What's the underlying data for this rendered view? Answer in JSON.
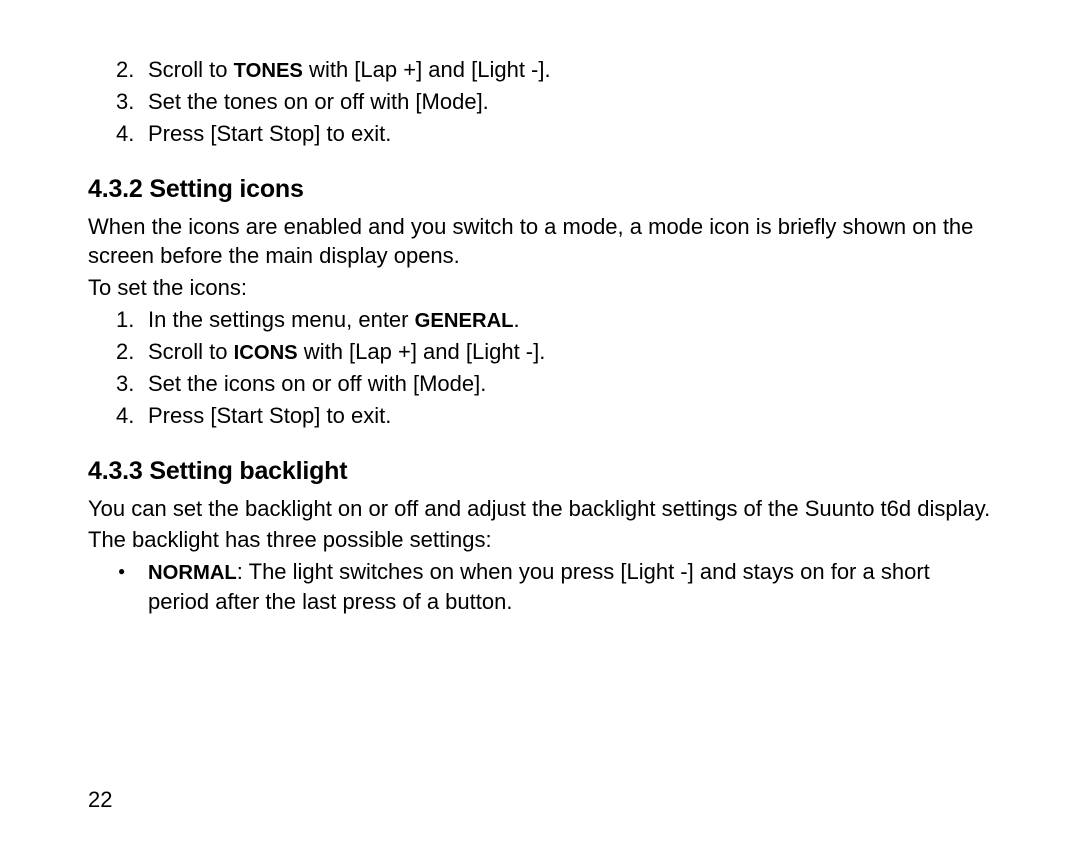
{
  "topList": {
    "items": [
      {
        "num": "2.",
        "pre": "Scroll to ",
        "bold": "TONES",
        "post": " with [Lap +] and [Light -]."
      },
      {
        "num": "3.",
        "pre": "Set the tones on or off with [Mode].",
        "bold": "",
        "post": ""
      },
      {
        "num": "4.",
        "pre": "Press [Start Stop] to exit.",
        "bold": "",
        "post": ""
      }
    ]
  },
  "section432": {
    "heading": "4.3.2  Setting icons",
    "p1": "When the icons are enabled and you switch to a mode, a mode icon is briefly shown on the screen before the main display opens.",
    "p2": "To set the icons:",
    "list": [
      {
        "num": "1.",
        "pre": "In the settings menu, enter ",
        "bold": "GENERAL",
        "post": "."
      },
      {
        "num": "2.",
        "pre": "Scroll to ",
        "bold": "ICONS",
        "post": " with [Lap +] and [Light -]."
      },
      {
        "num": "3.",
        "pre": "Set the icons on or off with [Mode].",
        "bold": "",
        "post": ""
      },
      {
        "num": "4.",
        "pre": "Press [Start Stop] to exit.",
        "bold": "",
        "post": ""
      }
    ]
  },
  "section433": {
    "heading": "4.3.3  Setting backlight",
    "p1": "You can set the backlight on or off and adjust the backlight settings of the Suunto t6d display.",
    "p2": "The backlight has three possible settings:",
    "bullet": {
      "bold": "NORMAL",
      "text": ": The light switches on when you press [Light -] and stays on for a short period after the last press of a button."
    }
  },
  "pageNumber": "22"
}
